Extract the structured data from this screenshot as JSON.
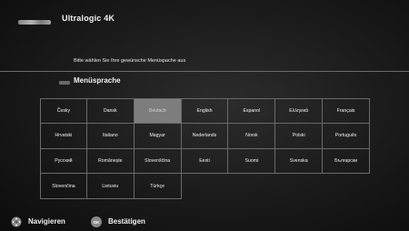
{
  "header": {
    "title": "Ultralogic 4K"
  },
  "instruction": "Bitte wählen Sie Ihre gewünsche Menüspache aus",
  "section": {
    "title": "Menüsprache",
    "icon": "menu-language-icon"
  },
  "languages": [
    [
      "Česky",
      "Dansk",
      "Deutsch",
      "English",
      "Espanol",
      "Ελληνικά",
      "Français"
    ],
    [
      "Hrvatski",
      "Italiano",
      "Magyar",
      "Nederlands",
      "Norsk",
      "Polski",
      "Português"
    ],
    [
      "Русский",
      "Românește",
      "Slovenščina",
      "Eesti",
      "Suomi",
      "Svenska",
      "Български"
    ],
    [
      "Slovenčina",
      "Lietuviu",
      "Türkçe",
      "",
      "",
      "",
      ""
    ]
  ],
  "selected_language": "Deutsch",
  "footer": {
    "navigate_label": "Navigieren",
    "navigate_icon": "dpad-icon",
    "confirm_label": "Bestätigen",
    "confirm_icon_text": "OK"
  },
  "colors": {
    "selected_cell": "#7d7d7d",
    "grid_lines": "#6a6a6a",
    "background": "#1a1a1a"
  }
}
